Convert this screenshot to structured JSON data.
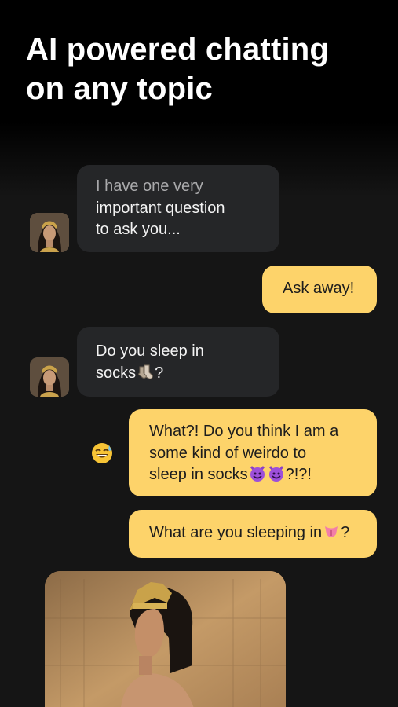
{
  "headline": {
    "line1": "AI powered chatting",
    "line2": "on any topic"
  },
  "messages": [
    {
      "sender": "ai",
      "lines": [
        "I have one very",
        "important question",
        "to ask you..."
      ]
    },
    {
      "sender": "user",
      "lines": [
        "Ask away!"
      ]
    },
    {
      "sender": "ai",
      "line1": "Do you sleep in",
      "line2_text": "socks",
      "line2_emoji": "socks-emoji",
      "line2_suffix": "?"
    },
    {
      "sender": "user",
      "reaction": "grinning-sweat-emoji",
      "line1": "What?! Do you think I am a",
      "line2": "some kind of weirdo to",
      "line3_text": "sleep in socks",
      "line3_emojis": [
        "smiling-devil-emoji",
        "smiling-devil-emoji"
      ],
      "line3_suffix": "?!?!"
    },
    {
      "sender": "user",
      "text": "What are you sleeping in",
      "emoji": "tongue-emoji",
      "suffix": "?"
    }
  ],
  "colors": {
    "user_bubble": "#fdd36a",
    "ai_bubble": "#252628",
    "background": "#151515",
    "headline": "#ffffff"
  }
}
